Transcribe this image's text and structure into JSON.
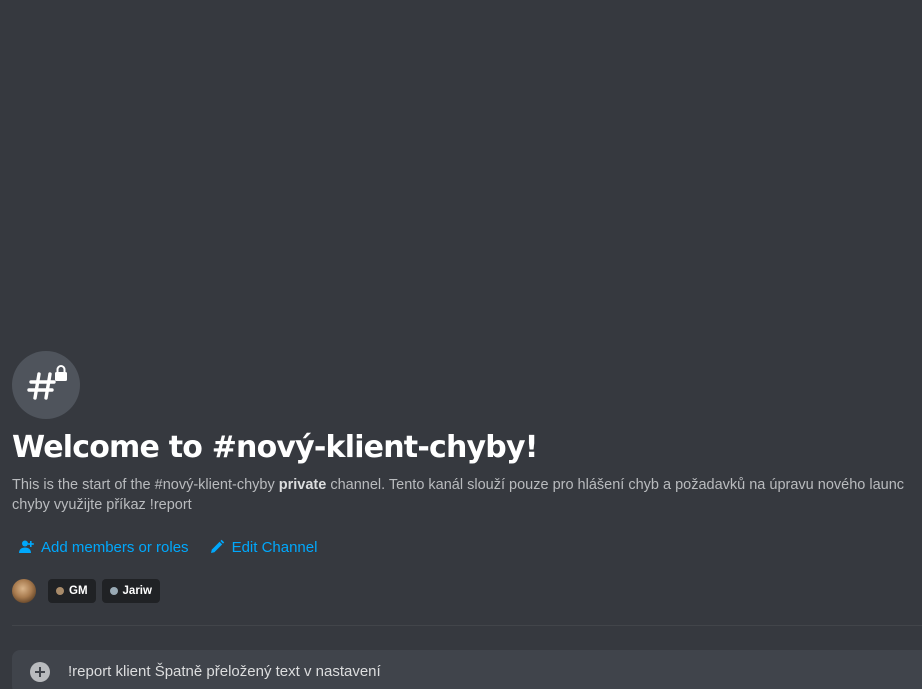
{
  "channel": {
    "icon": "hashtag-lock-icon",
    "welcome_title": "Welcome to #nový-klient-chyby!",
    "description_prefix": "This is the start of the #nový-klient-chyby ",
    "description_bold": "private",
    "description_suffix": " channel. Tento kanál slouží pouze pro hlášení chyb a požadavků na úpravu nového launc",
    "description_line2": "chyby využijte příkaz !report"
  },
  "actions": {
    "add_members_label": "Add members or roles",
    "add_members_icon": "add-person-icon",
    "edit_channel_label": "Edit Channel",
    "edit_channel_icon": "pencil-icon"
  },
  "members": {
    "avatar_icon": "user-avatar",
    "roles": [
      {
        "label": "GM",
        "color": "#a88b6a"
      },
      {
        "label": "Jariw",
        "color": "#99aab5"
      }
    ]
  },
  "composer": {
    "add_icon": "plus-circle-icon",
    "value": "!report klient Špatně přeložený text v nastavení"
  },
  "colors": {
    "background": "#36393f",
    "accent_link": "#00a8fc",
    "composer_bg": "#40444b"
  }
}
